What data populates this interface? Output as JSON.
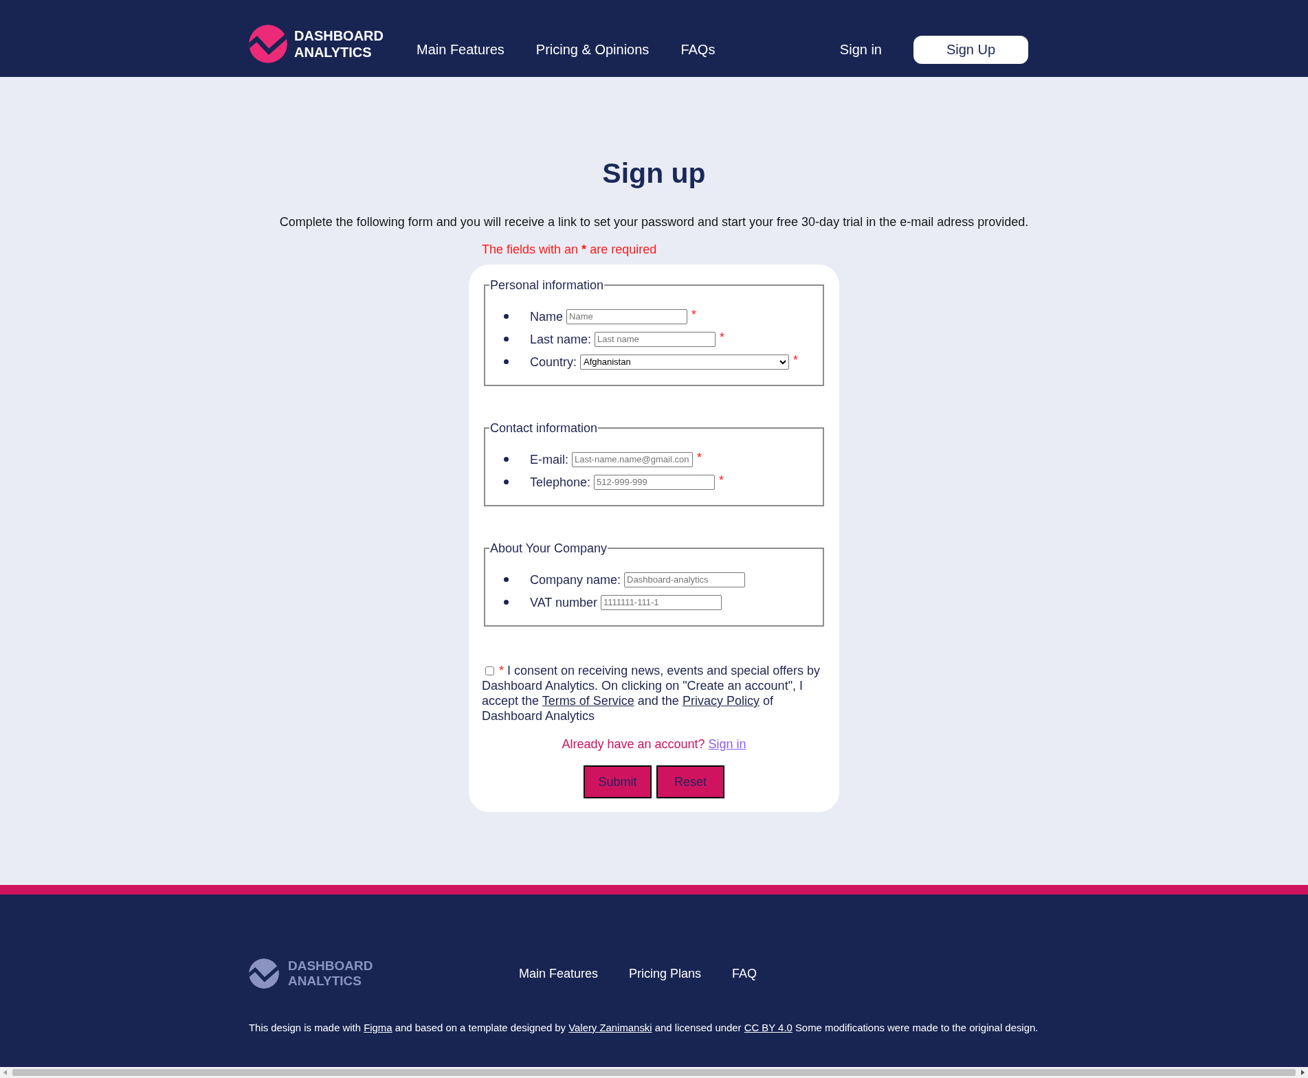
{
  "header": {
    "brand": "DASHBOARD ANALYTICS",
    "nav": [
      "Main Features",
      "Pricing & Opinions",
      "FAQs"
    ],
    "sign_in": "Sign in",
    "sign_up": "Sign Up"
  },
  "page": {
    "title": "Sign up",
    "intro": "Complete the following form and you will receive a link to set your password and start your free 30-day trial in the e-mail adress provided.",
    "required_note": {
      "before": "The fields with an",
      "mark": "*",
      "after": "are required"
    }
  },
  "form": {
    "fieldsets": [
      {
        "legend": "Personal information",
        "fields": [
          {
            "kind": "text",
            "label": "Name",
            "placeholder": "Name",
            "required_mark": "*"
          },
          {
            "kind": "text",
            "label": "Last name:",
            "placeholder": "Last name",
            "required_mark": "*"
          },
          {
            "kind": "select",
            "label": "Country:",
            "value": "Afghanistan",
            "required_mark": "*"
          }
        ]
      },
      {
        "legend": "Contact information",
        "fields": [
          {
            "kind": "text",
            "label": "E-mail:",
            "placeholder": "Last-name.name@gmail.con",
            "required_mark": "*"
          },
          {
            "kind": "text",
            "label": "Telephone:",
            "placeholder": "512-999-999",
            "required_mark": "*"
          }
        ]
      },
      {
        "legend": "About Your Company",
        "fields": [
          {
            "kind": "text",
            "label": "Company name:",
            "placeholder": "Dashboard-analytics"
          },
          {
            "kind": "text",
            "label": "VAT number",
            "placeholder": "1111111-111-1"
          }
        ]
      }
    ],
    "consent": {
      "checked": false,
      "mark": "*",
      "parts": [
        {
          "kind": "text",
          "text": "I consent on receiving news, events and special offers by Dashboard Analytics. On clicking on \"Create an account\", I accept the"
        },
        {
          "kind": "link",
          "text": "Terms of Service"
        },
        {
          "kind": "text",
          "text": "and the"
        },
        {
          "kind": "link",
          "text": "Privacy Policy"
        },
        {
          "kind": "text",
          "text": "of Dashboard Analytics"
        }
      ]
    },
    "signin_prompt": {
      "text": "Already have an account?",
      "link": "Sign in"
    },
    "buttons": [
      "Submit",
      "Reset"
    ]
  },
  "footer": {
    "brand": "DASHBOARD ANALYTICS",
    "nav": [
      "Main Features",
      "Pricing Plans",
      "FAQ"
    ],
    "credit": [
      {
        "kind": "text",
        "text": "This design is made with"
      },
      {
        "kind": "link",
        "text": "Figma"
      },
      {
        "kind": "text",
        "text": "and based on a template designed by"
      },
      {
        "kind": "link",
        "text": "Valery Zanimanski"
      },
      {
        "kind": "text",
        "text": "and licensed under"
      },
      {
        "kind": "link",
        "text": "CC BY 4.0"
      },
      {
        "kind": "text",
        "text": "Some modifications were made to the original design."
      }
    ]
  }
}
